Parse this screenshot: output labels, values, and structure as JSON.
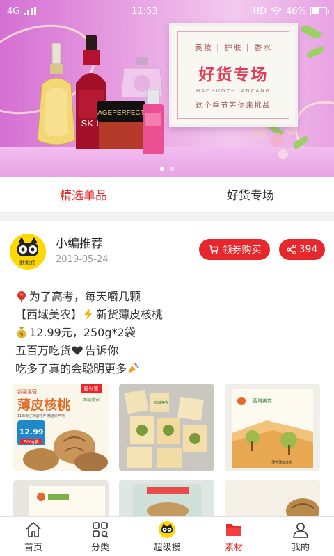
{
  "status_bar": {
    "network": "4G",
    "time": "11:53",
    "hd": "HD",
    "battery": "46%",
    "battery_level": 0.46
  },
  "banner": {
    "categories": "美妆 | 护肤 | 香水",
    "title": "好货专场",
    "pinyin": "HAOHUOZHUANCANG",
    "slogan": "这个季节等你来挑战",
    "product_brand": "SK-II",
    "product_name": "AGEPERFECT",
    "pages": 2,
    "active_page": 1
  },
  "tabs": [
    {
      "label": "精选单品",
      "active": true
    },
    {
      "label": "好货专场",
      "active": false
    }
  ],
  "post": {
    "author": "小编推荐",
    "avatar_label": "默默侦",
    "date": "2019-05-24",
    "buy_label": "领券购买",
    "share_count": "394",
    "lines": [
      {
        "icon": "rose-icon",
        "text": "为了高考，每天嚼几颗"
      },
      {
        "icon": "",
        "text": "【西域美农】"
      },
      {
        "icon": "lightning-icon",
        "text": "新货薄皮核桃"
      },
      {
        "icon": "money-bag-icon",
        "text": "12.99元，250g*2袋"
      },
      {
        "icon": "heart-icon",
        "text": "五百万吃货"
      },
      {
        "icon": "",
        "text": "告诉你"
      },
      {
        "icon": "party-popper-icon",
        "text": "吃多了真的会聪明更多"
      }
    ],
    "image1": {
      "badge": "聚划算",
      "subtitle": "新疆温宿",
      "title": "薄皮核桃",
      "brand": "西域美农",
      "tagline": "11年专注新疆特产 精选原产地",
      "price": "12.99",
      "weight": "500g装"
    },
    "image2": {
      "brand": "西域美农"
    },
    "image3": {
      "brand": "西域美农",
      "label": "薄壳薄皮核桃"
    }
  },
  "bottom_nav": [
    {
      "label": "首页",
      "icon": "home-icon",
      "active": false
    },
    {
      "label": "分类",
      "icon": "category-icon",
      "active": false
    },
    {
      "label": "超级搜",
      "icon": "cat-mascot-icon",
      "active": false
    },
    {
      "label": "素材",
      "icon": "folder-icon",
      "active": true
    },
    {
      "label": "我的",
      "icon": "profile-icon",
      "active": false
    }
  ],
  "colors": {
    "accent": "#e82b2b",
    "banner_pink": "#e9a6e3",
    "avatar_yellow": "#ffd800"
  }
}
